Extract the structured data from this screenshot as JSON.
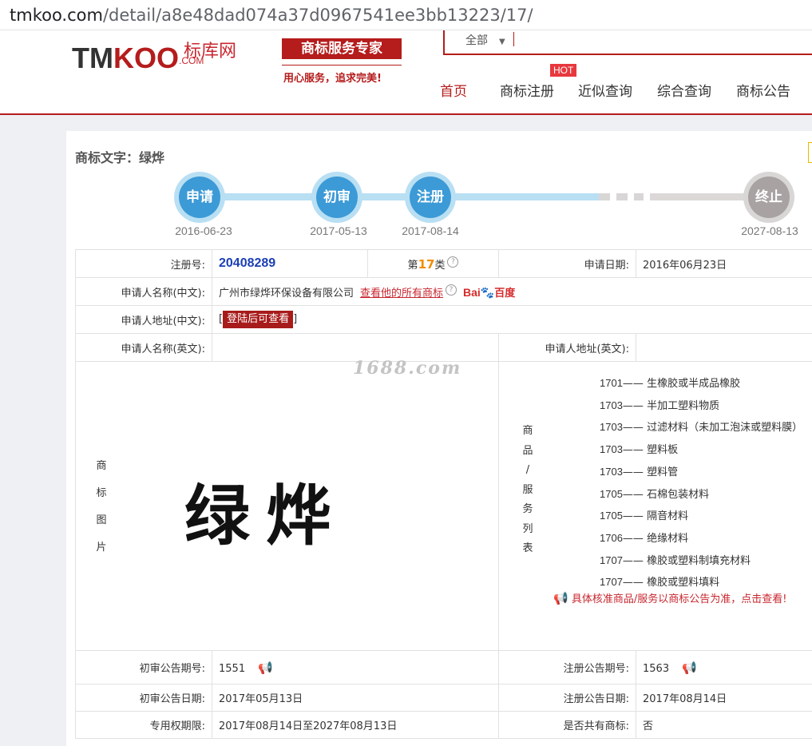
{
  "browser": {
    "url_host": "tmkoo.com",
    "url_path": "/detail/a8e48dad074a37d0967541ee3bb13223/17/"
  },
  "header": {
    "logo_tm": "TM",
    "logo_koo": "KOO",
    "logo_cn": "标库网",
    "logo_com": ".COM",
    "slogan": "商标服务专家",
    "slogan_sub": "用心服务，追求完美!",
    "search_scope": "全部",
    "nav": [
      "首页",
      "商标注册",
      "近似查询",
      "综合查询",
      "商标公告"
    ],
    "hot_badge": "HOT"
  },
  "detail": {
    "title": "商标文字：绿烨",
    "steps": [
      {
        "label": "申请",
        "date": "2016-06-23"
      },
      {
        "label": "初审",
        "date": "2017-05-13"
      },
      {
        "label": "注册",
        "date": "2017-08-14"
      },
      {
        "label": "终止",
        "date": "2027-08-13"
      }
    ],
    "reg_no_label": "注册号:",
    "reg_no": "20408289",
    "class_prefix": "第",
    "class_num": "17",
    "class_suffix": "类",
    "apply_date_label": "申请日期:",
    "apply_date": "2016年06月23日",
    "applicant_cn_label": "申请人名称(中文):",
    "applicant_cn": "广州市绿烨环保设备有限公司",
    "view_all_link": "查看他的所有商标",
    "baidu_a": "Bai",
    "baidu_b": "百度",
    "address_cn_label": "申请人地址(中文):",
    "address_cn_bracket_l": "[",
    "login_btn": "登陆后可查看",
    "address_cn_bracket_r": "]",
    "applicant_en_label": "申请人名称(英文):",
    "address_en_label": "申请人地址(英文):",
    "image_label": [
      "商",
      "标",
      "图",
      "片"
    ],
    "mark_text": "绿烨",
    "watermark": "1688.com",
    "goods_label": [
      "商",
      "品",
      "/",
      "服",
      "务",
      "列",
      "表"
    ],
    "goods": [
      {
        "code": "1701",
        "name": "生橡胶或半成品橡胶"
      },
      {
        "code": "1703",
        "name": "半加工塑料物质"
      },
      {
        "code": "1703",
        "name": "过滤材料（未加工泡沫或塑料膜）"
      },
      {
        "code": "1703",
        "name": "塑料板"
      },
      {
        "code": "1703",
        "name": "塑料管"
      },
      {
        "code": "1705",
        "name": "石棉包装材料"
      },
      {
        "code": "1705",
        "name": "隔音材料"
      },
      {
        "code": "1706",
        "name": "绝缘材料"
      },
      {
        "code": "1707",
        "name": "橡胶或塑料制填充材料"
      },
      {
        "code": "1707",
        "name": "橡胶或塑料填料"
      }
    ],
    "goods_sep": "——",
    "goods_notice": "具体核准商品/服务以商标公告为准，点击查看!",
    "prelim_issue_label": "初审公告期号:",
    "prelim_issue": "1551",
    "reg_issue_label": "注册公告期号:",
    "reg_issue": "1563",
    "prelim_date_label": "初审公告日期:",
    "prelim_date": "2017年05月13日",
    "reg_date_label": "注册公告日期:",
    "reg_date": "2017年08月14日",
    "term_label": "专用权期限:",
    "term": "2017年08月14日至2027年08月13日",
    "shared_label": "是否共有商标:",
    "shared": "否"
  },
  "colors": {
    "brand_red": "#b51c1c",
    "step_blue": "#3c9ad6",
    "step_light": "#b9dff3",
    "end_gray": "#a8a2a2"
  }
}
